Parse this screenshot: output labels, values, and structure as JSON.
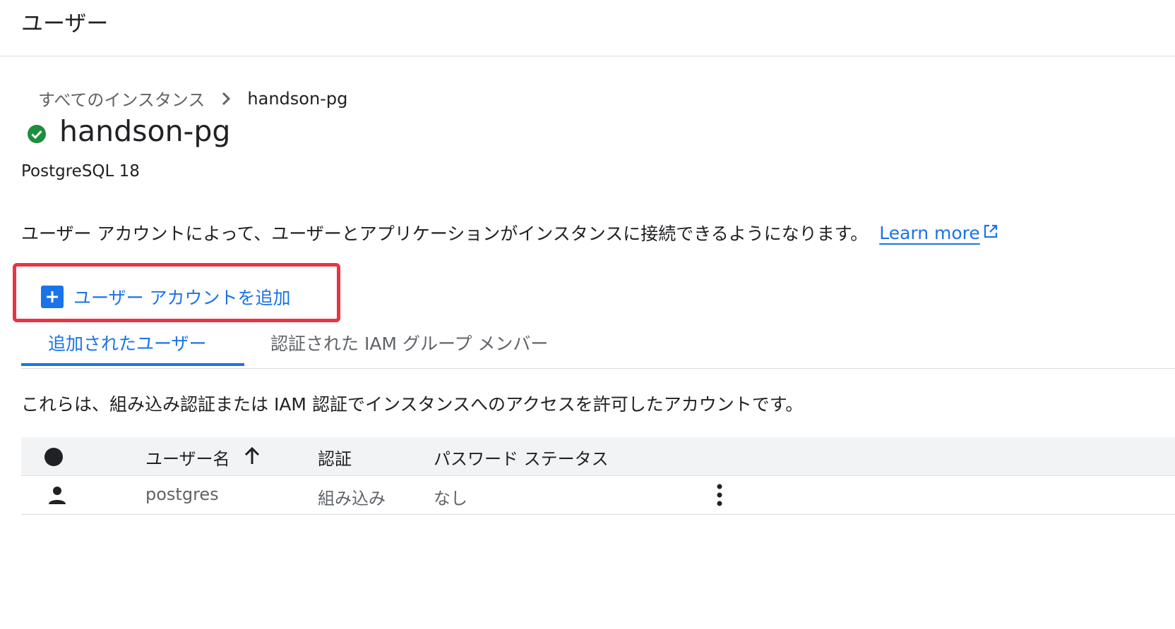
{
  "page": {
    "heading": "ユーザー"
  },
  "breadcrumb": {
    "root": "すべてのインスタンス",
    "current": "handson-pg"
  },
  "instance": {
    "name": "handson-pg",
    "status_icon": "check-circle-icon",
    "version": "PostgreSQL 18"
  },
  "description": {
    "text": "ユーザー アカウントによって、ユーザーとアプリケーションがインスタンスに接続できるようになります。",
    "link_label": "Learn more"
  },
  "actions": {
    "add_user_label": "ユーザー アカウントを追加"
  },
  "tabs": [
    {
      "label": "追加されたユーザー"
    },
    {
      "label": "認証された IAM グループ メンバー"
    }
  ],
  "tab_description": "これらは、組み込み認証または IAM 認証でインスタンスへのアクセスを許可したアカウントです。",
  "table": {
    "columns": [
      "ユーザー名",
      "認証",
      "パスワード ステータス"
    ],
    "rows": [
      {
        "icon": "person-icon",
        "username": "postgres",
        "auth": "組み込み",
        "password_status": "なし"
      }
    ]
  },
  "colors": {
    "accent": "#1a73e8",
    "success": "#1e8e3e",
    "highlight": "#ea3342"
  }
}
